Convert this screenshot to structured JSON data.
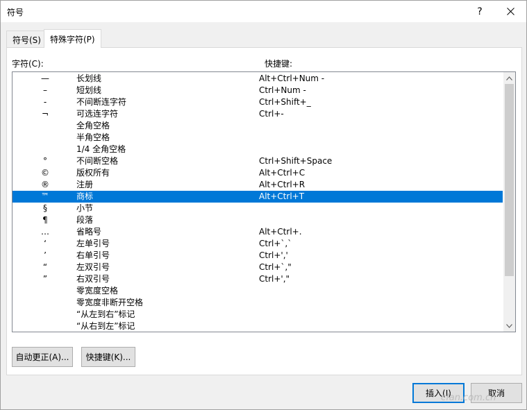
{
  "window": {
    "title": "符号",
    "help_label": "?"
  },
  "tabs": [
    {
      "label": "符号(S)",
      "active": false
    },
    {
      "label": "特殊字符(P)",
      "active": true
    }
  ],
  "columns": {
    "char_label": "字符(C):",
    "shortcut_label": "快捷键:"
  },
  "rows": [
    {
      "sym": "—",
      "name": "长划线",
      "key": "Alt+Ctrl+Num -"
    },
    {
      "sym": "–",
      "name": "短划线",
      "key": "Ctrl+Num -"
    },
    {
      "sym": "-",
      "name": "不间断连字符",
      "key": "Ctrl+Shift+_"
    },
    {
      "sym": "¬",
      "name": "可选连字符",
      "key": "Ctrl+-"
    },
    {
      "sym": "",
      "name": "全角空格",
      "key": ""
    },
    {
      "sym": "",
      "name": "半角空格",
      "key": ""
    },
    {
      "sym": "",
      "name": "1/4 全角空格",
      "key": ""
    },
    {
      "sym": "°",
      "name": "不间断空格",
      "key": "Ctrl+Shift+Space"
    },
    {
      "sym": "©",
      "name": "版权所有",
      "key": "Alt+Ctrl+C"
    },
    {
      "sym": "®",
      "name": "注册",
      "key": "Alt+Ctrl+R"
    },
    {
      "sym": "™",
      "name": "商标",
      "key": "Alt+Ctrl+T"
    },
    {
      "sym": "§",
      "name": "小节",
      "key": ""
    },
    {
      "sym": "¶",
      "name": "段落",
      "key": ""
    },
    {
      "sym": "…",
      "name": "省略号",
      "key": "Alt+Ctrl+."
    },
    {
      "sym": "‘",
      "name": "左单引号",
      "key": "Ctrl+`,`"
    },
    {
      "sym": "’",
      "name": "右单引号",
      "key": "Ctrl+','"
    },
    {
      "sym": "“",
      "name": "左双引号",
      "key": "Ctrl+`,\""
    },
    {
      "sym": "”",
      "name": "右双引号",
      "key": "Ctrl+',\""
    },
    {
      "sym": "",
      "name": "零宽度空格",
      "key": ""
    },
    {
      "sym": "",
      "name": "零宽度非断开空格",
      "key": ""
    },
    {
      "sym": "",
      "name": "“从左到右”标记",
      "key": ""
    },
    {
      "sym": "",
      "name": "“从右到左”标记",
      "key": ""
    }
  ],
  "selected_row": "商标",
  "buttons": {
    "autocorrect": "自动更正(A)...",
    "shortcut_key": "快捷键(K)...",
    "insert": "插入(I)",
    "cancel": "取消"
  },
  "watermark": "cfan.com.cn",
  "colors": {
    "selection": "#0078d7",
    "selection_text": "#ffffff"
  },
  "icons": {
    "close": "close-icon",
    "scroll_up": "chevron-up-icon",
    "scroll_down": "chevron-down-icon"
  }
}
